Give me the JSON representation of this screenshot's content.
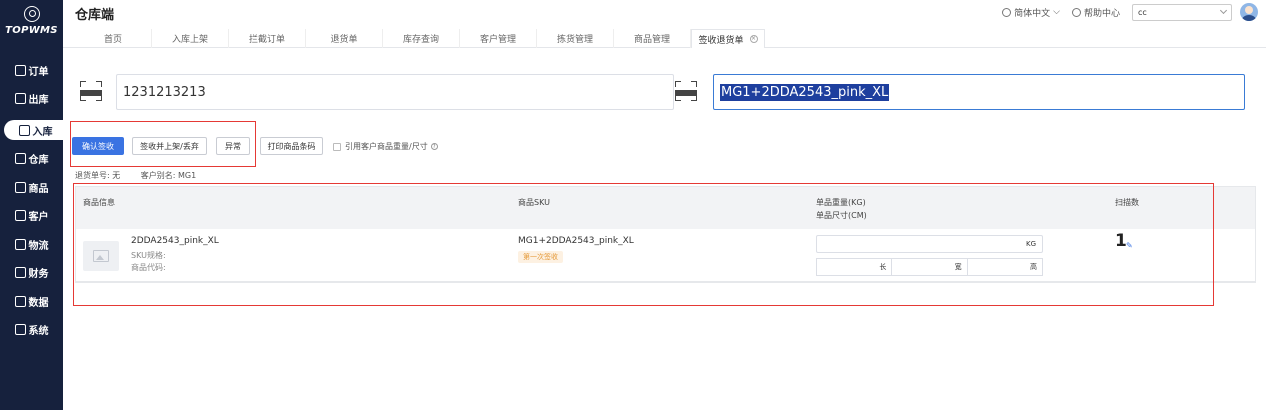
{
  "app": {
    "logo_text": "TOPWMS",
    "title": "仓库端"
  },
  "sidebar": {
    "items": [
      {
        "label": "订单"
      },
      {
        "label": "出库"
      },
      {
        "label": "入库",
        "active": true
      },
      {
        "label": "仓库"
      },
      {
        "label": "商品"
      },
      {
        "label": "客户"
      },
      {
        "label": "物流"
      },
      {
        "label": "财务"
      },
      {
        "label": "数据"
      },
      {
        "label": "系统"
      }
    ]
  },
  "header": {
    "language": "简体中文",
    "help": "帮助中心",
    "user_value": "cc"
  },
  "tabs": [
    {
      "label": "首页"
    },
    {
      "label": "入库上架"
    },
    {
      "label": "拦截订单"
    },
    {
      "label": "退货单"
    },
    {
      "label": "库存查询"
    },
    {
      "label": "客户管理"
    },
    {
      "label": "拣货管理"
    },
    {
      "label": "商品管理"
    },
    {
      "label": "签收退货单",
      "active": true,
      "close": "⊗"
    }
  ],
  "scan": {
    "left_value": "1231213213",
    "right_value": "MG1+2DDA2543_pink_XL"
  },
  "actions": {
    "confirm_sign": "确认签收",
    "sign_shelve_discard": "签收并上架/丢弃",
    "exception": "异常",
    "print_barcode": "打印商品条码",
    "use_customer_dims": "引用客户商品重量/尺寸",
    "help_mark": "?"
  },
  "info": {
    "return_no": "退货单号: 无",
    "customer_alias": "客户别名: MG1"
  },
  "table": {
    "headers": {
      "product_info": "商品信息",
      "sku": "商品SKU",
      "unit_weight": "单品重量(KG)",
      "unit_size": "单品尺寸(CM)",
      "scan_count": "扫描数"
    },
    "rows": [
      {
        "name": "2DDA2543_pink_XL",
        "sku_spec": "SKU规格:",
        "product_code": "商品代码:",
        "sku": "MG1+2DDA2543_pink_XL",
        "badge": "第一次签收",
        "weight_unit": "KG",
        "length_label": "长",
        "width_label": "宽",
        "height_label": "高",
        "scan_count": "1"
      }
    ]
  },
  "colors": {
    "sidebar_bg": "#16213d",
    "primary": "#3a73e2",
    "highlight_border": "#e53935",
    "badge": "#e59a3a"
  }
}
